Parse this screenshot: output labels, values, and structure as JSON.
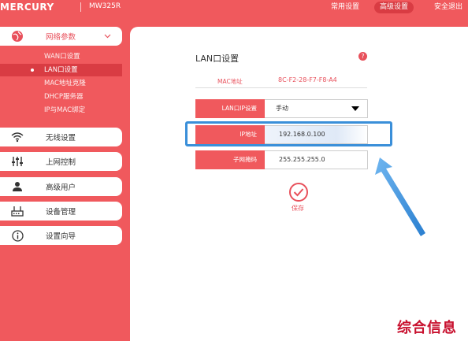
{
  "header": {
    "brand": "MERCURY",
    "model": "MW325R",
    "tabs": [
      {
        "label": "常用设置",
        "active": false
      },
      {
        "label": "高级设置",
        "active": true
      },
      {
        "label": "安全退出",
        "active": false
      }
    ]
  },
  "sidebar": {
    "groups": [
      {
        "label": "网络参数",
        "icon": "globe-icon",
        "expanded": true
      },
      {
        "label": "无线设置",
        "icon": "wifi-icon"
      },
      {
        "label": "上网控制",
        "icon": "sliders-icon"
      },
      {
        "label": "高级用户",
        "icon": "user-icon"
      },
      {
        "label": "设备管理",
        "icon": "router-icon"
      },
      {
        "label": "设置向导",
        "icon": "info-icon"
      }
    ],
    "subitems": [
      {
        "label": "WAN口设置",
        "active": false
      },
      {
        "label": "LAN口设置",
        "active": true
      },
      {
        "label": "MAC地址克隆",
        "active": false
      },
      {
        "label": "DHCP服务器",
        "active": false
      },
      {
        "label": "IP与MAC绑定",
        "active": false
      }
    ]
  },
  "main": {
    "title": "LAN口设置",
    "help": "?",
    "mac": {
      "label": "MAC地址",
      "value": "8C-F2-28-F7-F8-A4"
    },
    "lan_mode": {
      "label": "LAN口IP设置",
      "value": "手动"
    },
    "ip": {
      "label": "IP地址",
      "value": "192.168.0.100"
    },
    "mask": {
      "label": "子网掩码",
      "value": "255.255.255.0"
    },
    "save_label": "保存"
  },
  "watermark": "综合信息",
  "colors": {
    "primary": "#f0595d",
    "dark": "#d93c43",
    "callout": "#3a8fd9"
  }
}
